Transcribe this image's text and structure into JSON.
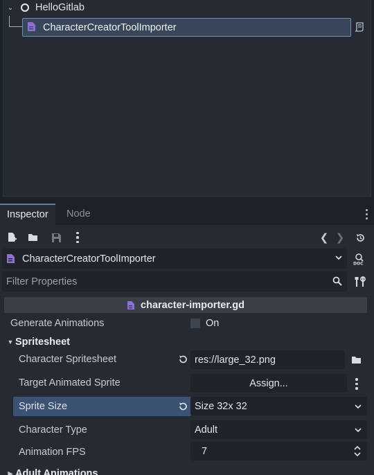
{
  "scene_tree": {
    "root": {
      "label": "HelloGitlab"
    },
    "child": {
      "label": "CharacterCreatorToolImporter"
    }
  },
  "dock": {
    "tabs": [
      {
        "label": "Inspector"
      },
      {
        "label": "Node"
      }
    ]
  },
  "inspector": {
    "object_name": "CharacterCreatorToolImporter",
    "filter_placeholder": "Filter Properties",
    "script_name": "character-importer.gd",
    "properties": {
      "generate_animations": {
        "label": "Generate Animations",
        "value": "On",
        "checked": false
      },
      "spritesheet_section": "Spritesheet",
      "character_spritesheet": {
        "label": "Character Spritesheet",
        "value": "res://large_32.png"
      },
      "target_animated_sprite": {
        "label": "Target Animated Sprite",
        "value": "Assign..."
      },
      "sprite_size": {
        "label": "Sprite Size",
        "value": "Size 32x 32"
      },
      "character_type": {
        "label": "Character Type",
        "value": "Adult"
      },
      "animation_fps": {
        "label": "Animation FPS",
        "value": "7"
      },
      "adult_animations_section": "Adult Animations"
    }
  },
  "colors": {
    "panel": "#262b33",
    "field": "#1f242b",
    "selection": "#384659",
    "highlight": "#3b5272",
    "script_accent": "#8f6fd6"
  }
}
